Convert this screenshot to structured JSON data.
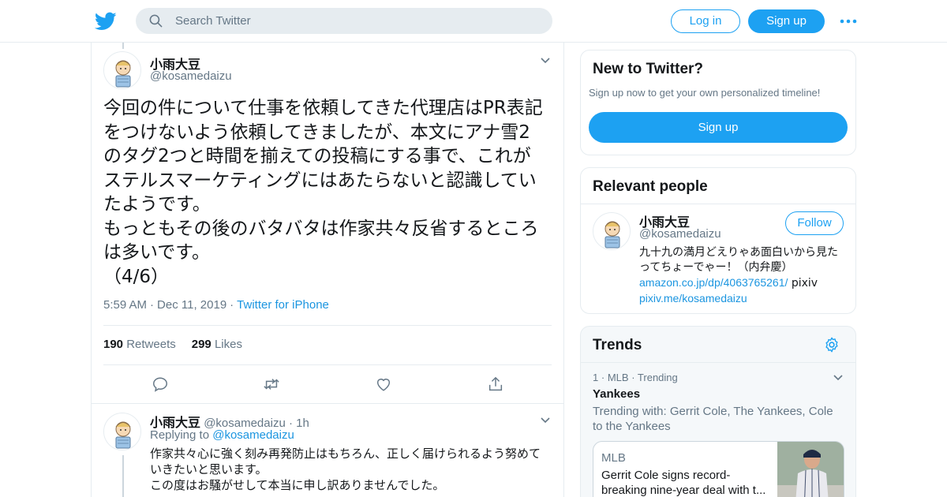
{
  "topbar": {
    "search_placeholder": "Search Twitter",
    "login_label": "Log in",
    "signup_label": "Sign up",
    "brand_color": "#1da1f2"
  },
  "tweet": {
    "author_name": "小雨大豆",
    "author_handle": "@kosamedaizu",
    "text_lines": [
      "今回の件について仕事を依頼してきた代理店はPR表記をつけないよう依頼してきましたが、本文にアナ雪2のタグ2つと時間を揃えての投稿にする事で、これがステルスマーケティングにはあたらないと認識していたようです。",
      "もっともその後のバタバタは作家共々反省するところは多いです。",
      "（4/6）"
    ],
    "time": "5:59 AM",
    "date": "Dec 11, 2019",
    "source": "Twitter for iPhone",
    "retweets_count": "190",
    "retweets_label": "Retweets",
    "likes_count": "299",
    "likes_label": "Likes"
  },
  "reply": {
    "author_name": "小雨大豆",
    "author_handle": "@kosamedaizu",
    "age": "1h",
    "replying_label": "Replying to",
    "replying_to": "@kosamedaizu",
    "text_lines": [
      "作家共々心に強く刻み再発防止はもちろん、正しく届けられるよう努めていきたいと思います。",
      "この度はお騒がせして本当に申し訳ありませんでした。"
    ]
  },
  "sidebar": {
    "new_title": "New to Twitter?",
    "new_sub": "Sign up now to get your own personalized timeline!",
    "new_signup_label": "Sign up",
    "relevant_title": "Relevant people",
    "person_name": "小雨大豆",
    "person_handle": "@kosamedaizu",
    "follow_label": "Follow",
    "bio_text": "九十九の満月どえりゃあ面白いから見たってちょーでゃー！（内弁慶）",
    "bio_link1": "amazon.co.jp/dp/4063765261/",
    "bio_word": "pixiv",
    "bio_link2": "pixiv.me/kosamedaizu",
    "trends_title": "Trends",
    "trend_rank": "1",
    "trend_category": "MLB",
    "trend_status": "Trending",
    "trend_name": "Yankees",
    "trend_with": "Trending with: Gerrit Cole, The Yankees, Cole to the Yankees",
    "news_category": "MLB",
    "news_title": "Gerrit Cole signs record-breaking nine-year deal with t..."
  }
}
